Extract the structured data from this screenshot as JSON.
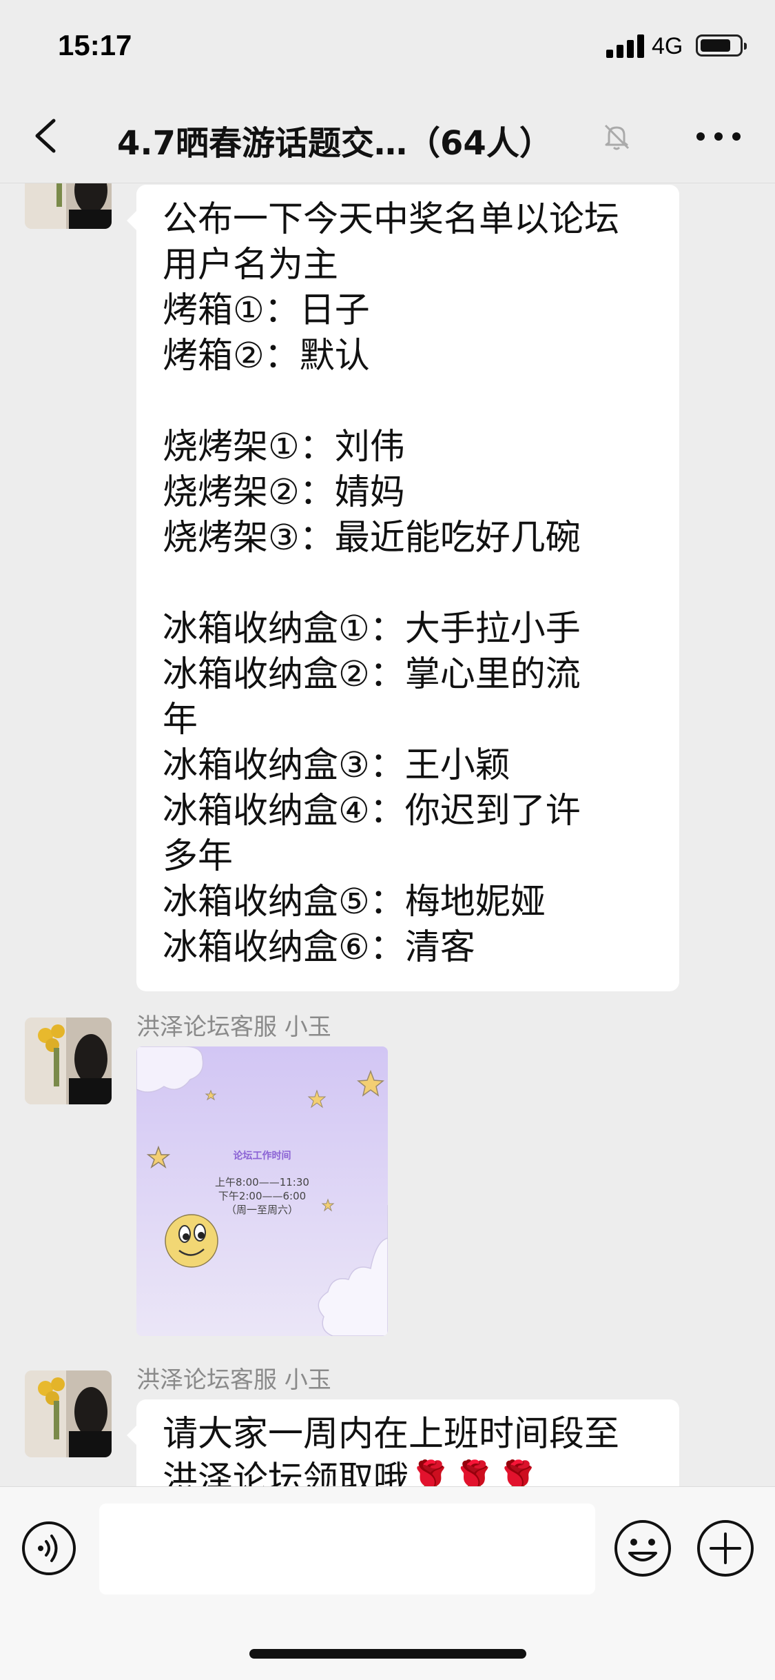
{
  "status_bar": {
    "time": "15:17",
    "network": "4G",
    "battery_level": 0.8
  },
  "header": {
    "title": "4.7晒春游话题交…（64人）",
    "back_icon": "chevron-left-icon",
    "mute_icon": "bell-slash-icon",
    "more_icon": "ellipsis-icon"
  },
  "messages": [
    {
      "type": "text",
      "lines": [
        "公布一下今天中奖名单以论坛",
        "用户名为主",
        "烤箱①：日子",
        "烤箱②：默认",
        "",
        "烧烤架①：刘伟",
        "烧烤架②：婧妈",
        "烧烤架③：最近能吃好几碗",
        "",
        "冰箱收纳盒①：大手拉小手",
        "冰箱收纳盒②：掌心里的流",
        "年",
        "冰箱收纳盒③：王小颖",
        "冰箱收纳盒④：你迟到了许",
        "多年",
        "冰箱收纳盒⑤：梅地妮娅",
        "冰箱收纳盒⑥：清客"
      ]
    },
    {
      "type": "image",
      "sender": "洪泽论坛客服 小玉",
      "image": {
        "title": "论坛工作时间",
        "lines": [
          "上午8:00——11:30",
          "下午2:00——6:00",
          "（周一至周六）"
        ]
      }
    },
    {
      "type": "text",
      "sender": "洪泽论坛客服 小玉",
      "lines": [
        "请大家一周内在上班时间段至",
        "洪泽论坛领取哦🌹🌹🌹"
      ]
    }
  ],
  "input_bar": {
    "voice_icon": "voice-icon",
    "emoji_icon": "smiley-icon",
    "plus_icon": "plus-circle-icon",
    "placeholder": ""
  }
}
